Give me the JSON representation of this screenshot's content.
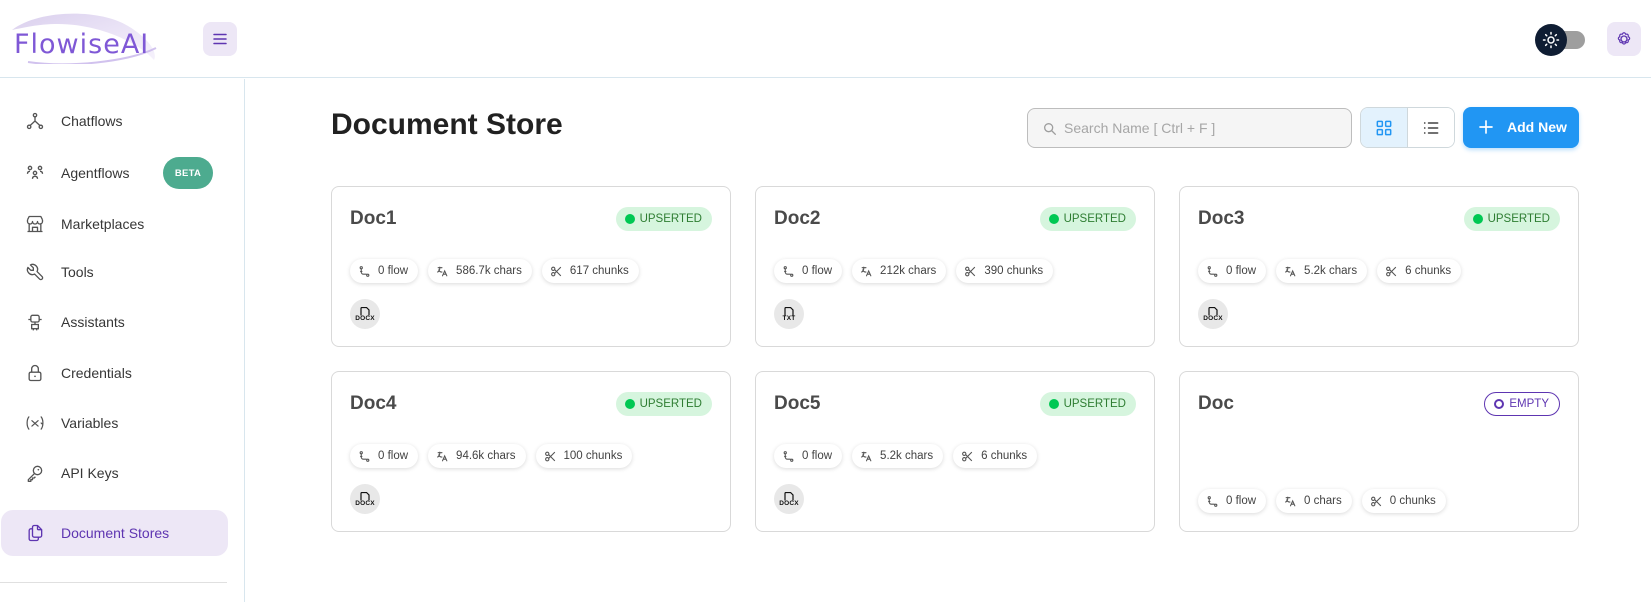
{
  "app": {
    "logo_text": "FlowiseAI"
  },
  "sidebar": {
    "items": [
      {
        "label": "Chatflows",
        "icon": "hierarchy-icon"
      },
      {
        "label": "Agentflows",
        "icon": "users-group-icon",
        "badge": "BETA"
      },
      {
        "label": "Marketplaces",
        "icon": "building-store-icon"
      },
      {
        "label": "Tools",
        "icon": "tool-icon"
      },
      {
        "label": "Assistants",
        "icon": "robot-icon"
      },
      {
        "label": "Credentials",
        "icon": "lock-icon"
      },
      {
        "label": "Variables",
        "icon": "variable-icon"
      },
      {
        "label": "API Keys",
        "icon": "key-icon"
      },
      {
        "label": "Document Stores",
        "icon": "files-icon",
        "active": true
      }
    ]
  },
  "main": {
    "title": "Document Store",
    "search_placeholder": "Search Name [ Ctrl + F ]",
    "add_new_label": "Add New"
  },
  "cards": [
    {
      "name": "Doc1",
      "status": "UPSERTED",
      "flows": "0 flow",
      "chars": "586.7k chars",
      "chunks": "617 chunks",
      "file_ext": "DOCX"
    },
    {
      "name": "Doc2",
      "status": "UPSERTED",
      "flows": "0 flow",
      "chars": "212k chars",
      "chunks": "390 chunks",
      "file_ext": "TXT"
    },
    {
      "name": "Doc3",
      "status": "UPSERTED",
      "flows": "0 flow",
      "chars": "5.2k chars",
      "chunks": "6 chunks",
      "file_ext": "DOCX"
    },
    {
      "name": "Doc4",
      "status": "UPSERTED",
      "flows": "0 flow",
      "chars": "94.6k chars",
      "chunks": "100 chunks",
      "file_ext": "DOCX"
    },
    {
      "name": "Doc5",
      "status": "UPSERTED",
      "flows": "0 flow",
      "chars": "5.2k chars",
      "chunks": "6 chunks",
      "file_ext": "DOCX"
    },
    {
      "name": "Doc",
      "status": "EMPTY",
      "flows": "0 flow",
      "chars": "0 chars",
      "chunks": "0 chunks",
      "file_ext": ""
    }
  ],
  "colors": {
    "primary": "#2196f3",
    "accent_purple": "#5e35b1",
    "upserted_bg": "#d6f5de",
    "upserted_dot": "#00c853",
    "beta_green": "#4dab8f"
  }
}
